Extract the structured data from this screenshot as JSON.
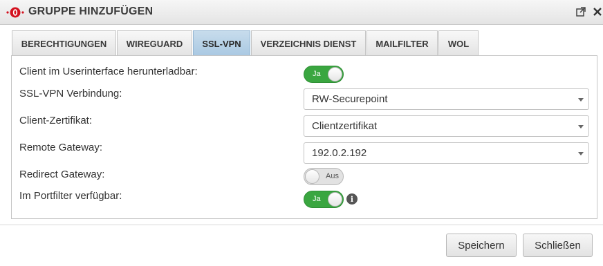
{
  "dialog": {
    "title": "GRUPPE HINZUFÜGEN"
  },
  "tabs": [
    {
      "label": "BERECHTIGUNGEN",
      "active": false
    },
    {
      "label": "WIREGUARD",
      "active": false
    },
    {
      "label": "SSL-VPN",
      "active": true
    },
    {
      "label": "VERZEICHNIS DIENST",
      "active": false
    },
    {
      "label": "MAILFILTER",
      "active": false
    },
    {
      "label": "WOL",
      "active": false
    }
  ],
  "form": {
    "client_download": {
      "label": "Client im Userinterface herunterladbar:",
      "toggle": "Ja",
      "on": true
    },
    "ssl_vpn_connection": {
      "label": "SSL-VPN Verbindung:",
      "value": "RW-Securepoint"
    },
    "client_certificate": {
      "label": "Client-Zertifikat:",
      "value": "Clientzertifikat"
    },
    "remote_gateway": {
      "label": "Remote Gateway:",
      "value": "192.0.2.192"
    },
    "redirect_gateway": {
      "label": "Redirect Gateway:",
      "toggle": "Aus",
      "on": false
    },
    "portfilter": {
      "label": "Im Portfilter verfügbar:",
      "toggle": "Ja",
      "on": true
    }
  },
  "buttons": {
    "save": "Speichern",
    "close": "Schließen"
  },
  "icons": {
    "logo": "securepoint-logo-icon",
    "popout": "popout-icon",
    "close": "close-icon",
    "info": "info-icon"
  },
  "colors": {
    "toggle_on": "#3aa640",
    "active_tab": "#b5d0e6",
    "logo_red": "#d3121f"
  }
}
